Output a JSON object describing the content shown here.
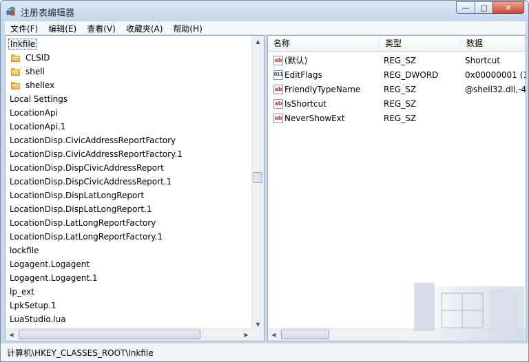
{
  "window": {
    "title": "注册表编辑器",
    "minimize": "—",
    "maximize": "□",
    "close": "✕"
  },
  "menu": [
    "文件(F)",
    "编辑(E)",
    "查看(V)",
    "收藏夹(A)",
    "帮助(H)"
  ],
  "tree": [
    {
      "label": "lnkfile",
      "selected": true,
      "folder": false
    },
    {
      "label": "CLSID",
      "folder": true
    },
    {
      "label": "shell",
      "folder": true
    },
    {
      "label": "shellex",
      "folder": true
    },
    {
      "label": "Local Settings",
      "folder": false
    },
    {
      "label": "LocationApi",
      "folder": false
    },
    {
      "label": "LocationApi.1",
      "folder": false
    },
    {
      "label": "LocationDisp.CivicAddressReportFactory",
      "folder": false
    },
    {
      "label": "LocationDisp.CivicAddressReportFactory.1",
      "folder": false
    },
    {
      "label": "LocationDisp.DispCivicAddressReport",
      "folder": false
    },
    {
      "label": "LocationDisp.DispCivicAddressReport.1",
      "folder": false
    },
    {
      "label": "LocationDisp.DispLatLongReport",
      "folder": false
    },
    {
      "label": "LocationDisp.DispLatLongReport.1",
      "folder": false
    },
    {
      "label": "LocationDisp.LatLongReportFactory",
      "folder": false
    },
    {
      "label": "LocationDisp.LatLongReportFactory.1",
      "folder": false
    },
    {
      "label": "lockfile",
      "folder": false
    },
    {
      "label": "Logagent.Logagent",
      "folder": false
    },
    {
      "label": "Logagent.Logagent.1",
      "folder": false
    },
    {
      "label": "lp_ext",
      "folder": false
    },
    {
      "label": "LpkSetup.1",
      "folder": false
    },
    {
      "label": "LuaStudio.lua",
      "folder": false
    }
  ],
  "columns": {
    "name": "名称",
    "type": "类型",
    "data": "数据"
  },
  "values": [
    {
      "name": "(默认)",
      "type": "REG_SZ",
      "data": "Shortcut",
      "icon": "ab"
    },
    {
      "name": "EditFlags",
      "type": "REG_DWORD",
      "data": "0x00000001 (1",
      "icon": "bin"
    },
    {
      "name": "FriendlyTypeName",
      "type": "REG_SZ",
      "data": "@shell32.dll,-4",
      "icon": "ab"
    },
    {
      "name": "IsShortcut",
      "type": "REG_SZ",
      "data": "",
      "icon": "ab"
    },
    {
      "name": "NeverShowExt",
      "type": "REG_SZ",
      "data": "",
      "icon": "ab"
    }
  ],
  "status": "计算机\\HKEY_CLASSES_ROOT\\lnkfile"
}
